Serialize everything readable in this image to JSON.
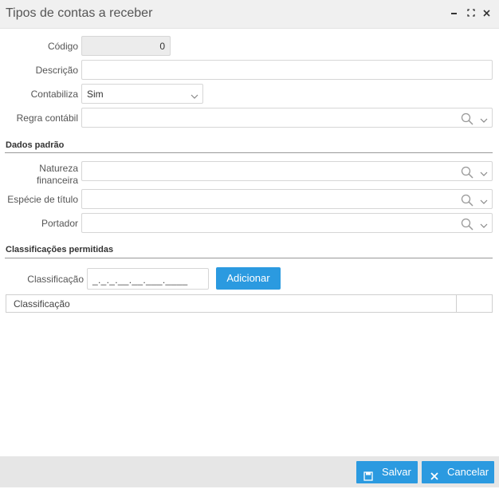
{
  "window": {
    "title": "Tipos de contas a receber"
  },
  "form": {
    "codigo": {
      "label": "Código",
      "value": "0"
    },
    "descricao": {
      "label": "Descrição",
      "value": ""
    },
    "contabiliza": {
      "label": "Contabiliza",
      "value": "Sim"
    },
    "regra": {
      "label": "Regra contábil",
      "value": ""
    }
  },
  "dados_padrao": {
    "title": "Dados padrão",
    "natureza": {
      "label_line1": "Natureza",
      "label_line2": "financeira",
      "value": ""
    },
    "especie": {
      "label": "Espécie de título",
      "value": ""
    },
    "portador": {
      "label": "Portador",
      "value": ""
    }
  },
  "classificacoes": {
    "title": "Classificações permitidas",
    "label": "Classificação",
    "mask": "_._._.__.__.___.____",
    "add_button": "Adicionar",
    "grid_header": "Classificação"
  },
  "footer": {
    "save": "Salvar",
    "cancel": "Cancelar"
  },
  "colors": {
    "primary": "#2b9ae0",
    "titlebar": "#f0f0f0",
    "footer": "#e6e6e6"
  },
  "icons": [
    "minimize-icon",
    "maximize-icon",
    "close-icon",
    "search-icon",
    "chevron-down-icon",
    "save-icon",
    "cancel-icon"
  ]
}
